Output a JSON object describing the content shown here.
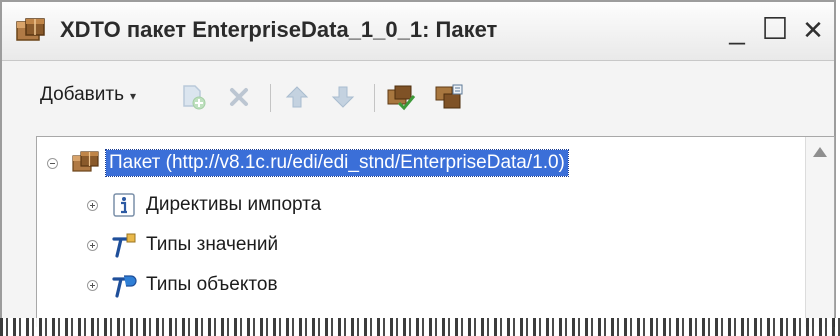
{
  "window": {
    "title": "XDTO пакет EnterpriseData_1_0_1: Пакет",
    "controls": {
      "minimize": "_",
      "maximize": "☐",
      "close": "✕"
    }
  },
  "toolbar": {
    "add_label": "Добавить",
    "add_caret": "▾",
    "icons": [
      "copy-icon",
      "delete-icon",
      "move-up-icon",
      "move-down-icon",
      "check-package-icon",
      "import-package-icon"
    ]
  },
  "tree": {
    "root": {
      "label": "Пакет (http://v8.1c.ru/edi/edi_stnd/EnterpriseData/1.0)",
      "expanded": true,
      "selected": true
    },
    "children": [
      {
        "label": "Директивы импорта",
        "icon": "info-icon"
      },
      {
        "label": "Типы значений",
        "icon": "value-type-icon"
      },
      {
        "label": "Типы объектов",
        "icon": "object-type-icon"
      }
    ]
  },
  "colors": {
    "selection": "#3b6fd8",
    "disabled_icon": "#b9c9da",
    "package_brown": "#8a5a2b",
    "accent_green": "#3e9a3a"
  }
}
